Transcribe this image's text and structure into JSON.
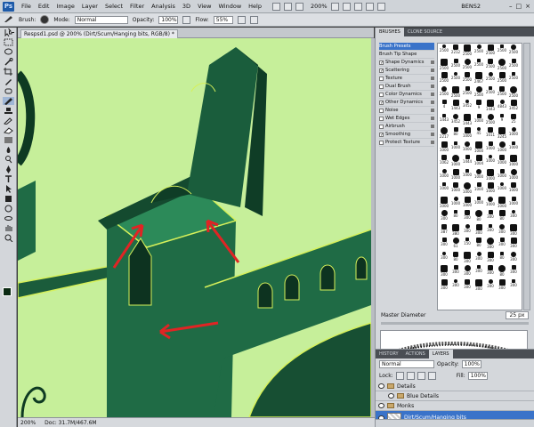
{
  "app": {
    "logo": "Ps",
    "menu": [
      "File",
      "Edit",
      "Image",
      "Layer",
      "Select",
      "Filter",
      "Analysis",
      "3D",
      "View",
      "Window",
      "Help"
    ],
    "zoom": "200%",
    "workspace": "BENS2",
    "window_buttons": [
      "–",
      "□",
      "×"
    ]
  },
  "options": {
    "brush_label": "Brush:",
    "mode_label": "Mode:",
    "mode_value": "Normal",
    "opacity_label": "Opacity:",
    "opacity_value": "100%",
    "flow_label": "Flow:",
    "flow_value": "55%"
  },
  "document": {
    "tab_title": "Respsd1.psd @ 200% (Dirt/Scum/Hanging bits, RGB/8) *",
    "status_zoom": "200%",
    "status_doc": "Doc: 31.7M/467.6M",
    "colors": {
      "sky": "#c6ef9a",
      "tower": "#1f6b45",
      "tower_dark": "#0f3d26",
      "highlight": "#d6f05a",
      "arrow": "#e02424"
    }
  },
  "brushes_panel": {
    "tabs": [
      "BRUSHES",
      "CLONE SOURCE"
    ],
    "options": [
      {
        "label": "Brush Presets",
        "checked": null,
        "selected": true
      },
      {
        "label": "Brush Tip Shape",
        "checked": null,
        "selected": false
      },
      {
        "label": "Shape Dynamics",
        "checked": true,
        "selected": false
      },
      {
        "label": "Scattering",
        "checked": true,
        "selected": false
      },
      {
        "label": "Texture",
        "checked": false,
        "selected": false
      },
      {
        "label": "Dual Brush",
        "checked": false,
        "selected": false
      },
      {
        "label": "Color Dynamics",
        "checked": false,
        "selected": false
      },
      {
        "label": "Other Dynamics",
        "checked": true,
        "selected": false
      },
      {
        "label": "Noise",
        "checked": false,
        "selected": false
      },
      {
        "label": "Wet Edges",
        "checked": false,
        "selected": false
      },
      {
        "label": "Airbrush",
        "checked": false,
        "selected": false
      },
      {
        "label": "Smoothing",
        "checked": true,
        "selected": false
      },
      {
        "label": "Protect Texture",
        "checked": false,
        "selected": false
      }
    ],
    "preset_sizes": [
      "2500",
      "2212",
      "2500",
      "2500",
      "2500",
      "2500",
      "2500",
      "2500",
      "2500",
      "2500",
      "2500",
      "2500",
      "2500",
      "2500",
      "2500",
      "2500",
      "2500",
      "2467",
      "2500",
      "2500",
      "2500",
      "2500",
      "2500",
      "2500",
      "2500",
      "2500",
      "2500",
      "2500",
      "4",
      "1443",
      "3452",
      "9",
      "1443",
      "4843",
      "3452",
      "1443",
      "3452",
      "1443",
      "1000",
      "2500",
      "9",
      "25",
      "2217",
      "80",
      "1000",
      "45",
      "1011",
      "3245",
      "1000",
      "1000",
      "1000",
      "1000",
      "1000",
      "1000",
      "1000",
      "1000",
      "1062",
      "1000",
      "1444",
      "1004",
      "1000",
      "1000",
      "1000",
      "1000",
      "1000",
      "1000",
      "1000",
      "1000",
      "1000",
      "1000",
      "1000",
      "1000",
      "1000",
      "1000",
      "1000",
      "1000",
      "1000",
      "1000",
      "1000",
      "1000",
      "1000",
      "1000",
      "1000",
      "1000",
      "300",
      "80",
      "300",
      "80",
      "300",
      "80",
      "300",
      "387",
      "380",
      "300",
      "300",
      "300",
      "300",
      "300",
      "300",
      "61",
      "150",
      "80",
      "300",
      "300",
      "300",
      "300",
      "80",
      "300",
      "300",
      "300",
      "80",
      "300",
      "300",
      "300",
      "300",
      "300",
      "300",
      "80",
      "300",
      "300",
      "300",
      "300",
      "300",
      "300",
      "300",
      "300"
    ],
    "master_diameter_label": "Master Diameter",
    "master_diameter_value": "25 px"
  },
  "layers_panel": {
    "tabs": [
      "HISTORY",
      "ACTIONS",
      "LAYERS"
    ],
    "blend_mode": "Normal",
    "opacity_label": "Opacity:",
    "opacity_value": "100%",
    "lock_label": "Lock:",
    "fill_label": "Fill:",
    "fill_value": "100%",
    "layers": [
      {
        "name": "Details",
        "type": "group",
        "active": false
      },
      {
        "name": "Blue Details",
        "type": "group",
        "active": false
      },
      {
        "name": "Monks",
        "type": "group",
        "active": false
      },
      {
        "name": "Dirt/Scum/Hanging bits",
        "type": "layer",
        "active": true
      }
    ]
  }
}
